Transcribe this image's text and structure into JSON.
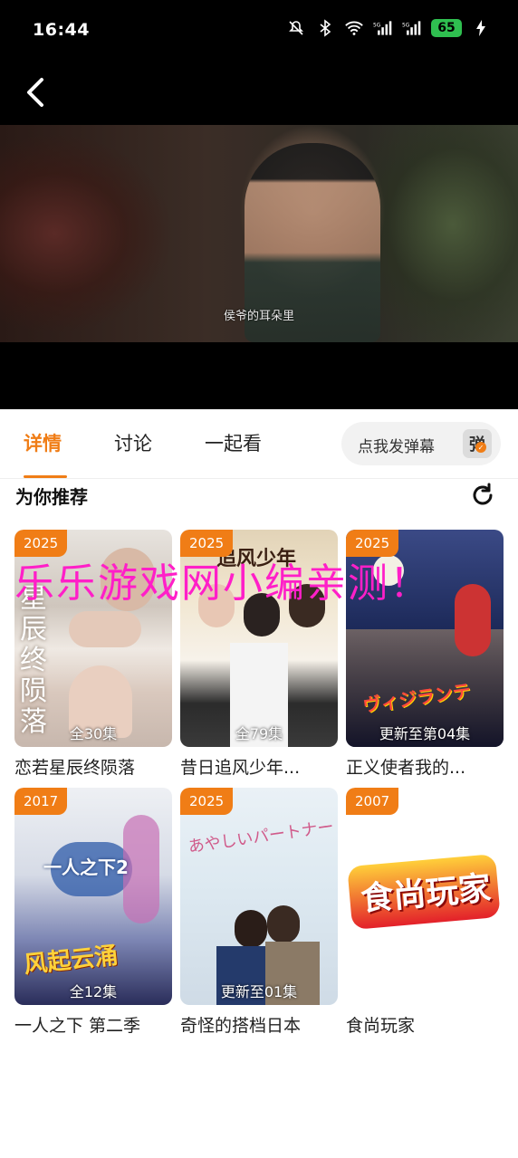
{
  "status": {
    "time": "16:44",
    "battery": "65"
  },
  "video": {
    "subtitle": "侯爷的耳朵里"
  },
  "tabs": [
    {
      "label": "详情"
    },
    {
      "label": "讨论"
    },
    {
      "label": "一起看"
    }
  ],
  "danmu": {
    "label": "点我发弹幕",
    "icon_text": "弹"
  },
  "section": {
    "title": "为你推荐"
  },
  "watermark": "乐乐游戏网小编亲测！",
  "recommendations": [
    {
      "year": "2025",
      "episodes": "全30集",
      "title": "恋若星辰终陨落",
      "poster_text": "星辰终陨落"
    },
    {
      "year": "2025",
      "episodes": "全79集",
      "title": "昔日追风少年...",
      "poster_text": "追风少年"
    },
    {
      "year": "2025",
      "episodes": "更新至第04集",
      "title": "正义使者我的...",
      "poster_text": "ヴィジランテ"
    },
    {
      "year": "2017",
      "episodes": "全12集",
      "title": "一人之下 第二季",
      "poster_text": "一人之下2"
    },
    {
      "year": "2025",
      "episodes": "更新至01集",
      "title": "奇怪的搭档日本",
      "poster_text": "あやしいパートナー"
    },
    {
      "year": "2007",
      "episodes": "",
      "title": "食尚玩家",
      "poster_text": "食尚玩家"
    }
  ],
  "colors": {
    "accent": "#f07d16",
    "watermark": "#ff1fc8"
  },
  "icons": [
    "back-arrow-icon",
    "mute-icon",
    "bluetooth-icon",
    "wifi-icon",
    "signal-icon",
    "charging-icon",
    "refresh-icon"
  ]
}
